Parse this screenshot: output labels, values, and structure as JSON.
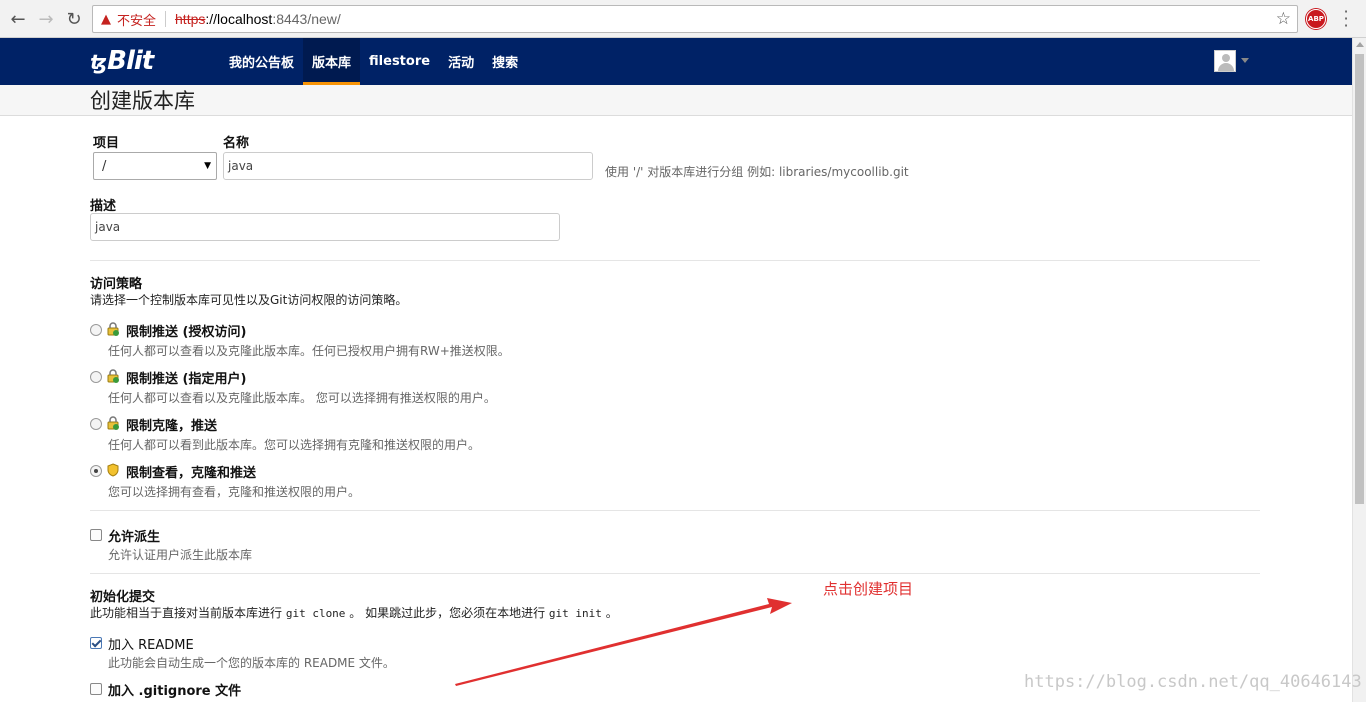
{
  "browser": {
    "insecure_label": "不安全",
    "url_scheme": "https",
    "url_host": "://localhost",
    "url_rest": ":8443/new/",
    "ext_label": "ABP"
  },
  "navbar": {
    "brand": "Blit",
    "brand_symbol": "ꜩ",
    "items": [
      {
        "label": "我的公告板"
      },
      {
        "label": "版本库"
      },
      {
        "label": "filestore"
      },
      {
        "label": "活动"
      },
      {
        "label": "搜索"
      }
    ],
    "active_index": 1
  },
  "page": {
    "title": "创建版本库"
  },
  "form": {
    "project_label": "项目",
    "project_value": "/",
    "name_label": "名称",
    "name_value": "java",
    "name_help": "使用 '/' 对版本库进行分组 例如:  libraries/mycoollib.git",
    "desc_label": "描述",
    "desc_value": "java"
  },
  "access": {
    "title": "访问策略",
    "subtitle": "请选择一个控制版本库可见性以及Git访问权限的访问策略。",
    "options": [
      {
        "title": "限制推送 (授权访问)",
        "desc": "任何人都可以查看以及克隆此版本库。任何已授权用户拥有RW+推送权限。",
        "checked": false
      },
      {
        "title": "限制推送 (指定用户)",
        "desc": "任何人都可以查看以及克隆此版本库。 您可以选择拥有推送权限的用户。",
        "checked": false
      },
      {
        "title": "限制克隆，推送",
        "desc": "任何人都可以看到此版本库。您可以选择拥有克隆和推送权限的用户。",
        "checked": false
      },
      {
        "title": "限制查看，克隆和推送",
        "desc": "您可以选择拥有查看，克隆和推送权限的用户。",
        "checked": true
      }
    ]
  },
  "fork": {
    "title": "允许派生",
    "desc": "允许认证用户派生此版本库"
  },
  "init": {
    "title": "初始化提交",
    "desc_before": "此功能相当于直接对当前版本库进行 ",
    "cmd_clone": "git clone",
    "desc_middle": " 。 如果跳过此步，您必须在本地进行 ",
    "cmd_init": "git init",
    "desc_after": " 。",
    "readme_title": "加入 README",
    "readme_desc": "此功能会自动生成一个您的版本库的 README 文件。",
    "gitignore_title": "加入 .gitignore 文件"
  },
  "annotation": {
    "text": "点击创建项目",
    "color": "#e03030"
  },
  "watermark": "https://blog.csdn.net/qq_40646143",
  "colors": {
    "navbar": "#002266",
    "active_underline": "#f89406"
  }
}
